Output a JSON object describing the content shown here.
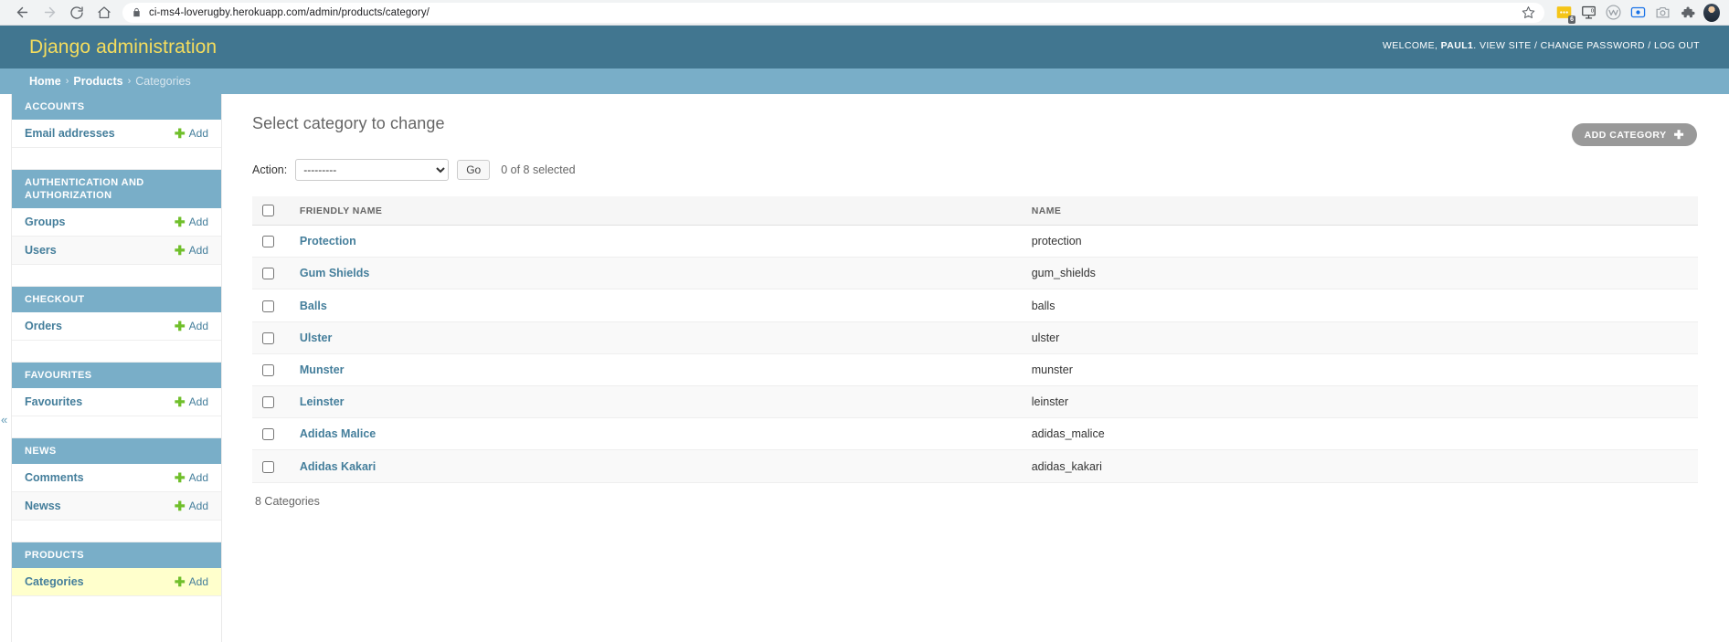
{
  "browser": {
    "back_icon": "arrow-left-icon",
    "forward_icon": "arrow-right-icon",
    "reload_icon": "reload-icon",
    "home_icon": "home-icon",
    "lock_icon": "lock-icon",
    "url_prefix": "ci-ms4-loverugby.herokuapp.com",
    "url_path": "/admin/products/category/",
    "url_full": "ci-ms4-loverugby.herokuapp.com/admin/products/category/",
    "star_icon": "bookmark-star-icon",
    "extensions": [
      {
        "name": "notes-extension-icon",
        "badge": "6"
      },
      {
        "name": "screen-capture-extension-icon",
        "badge": ""
      },
      {
        "name": "wave-extension-icon",
        "badge": ""
      },
      {
        "name": "recorder-extension-icon",
        "badge": ""
      },
      {
        "name": "camera-extension-icon",
        "badge": ""
      },
      {
        "name": "puzzle-extensions-icon",
        "badge": ""
      }
    ],
    "profile_icon": "user-avatar-icon"
  },
  "header": {
    "branding": "Django administration",
    "welcome_prefix": "WELCOME,",
    "username": "PAUL1",
    "punct": ".",
    "view_site": "VIEW SITE",
    "change_password": "CHANGE PASSWORD",
    "log_out": "LOG OUT",
    "separator": "/"
  },
  "breadcrumbs": {
    "items": [
      {
        "label": "Home",
        "current": false
      },
      {
        "label": "Products",
        "current": false
      },
      {
        "label": "Categories",
        "current": true
      }
    ],
    "separator": "›"
  },
  "sidebar": {
    "toggle_icon": "collapse-sidebar-icon",
    "toggle_label": "«",
    "add_label": "Add",
    "add_icon": "plus-icon",
    "apps": [
      {
        "title": "ACCOUNTS",
        "models": [
          {
            "label": "Email addresses",
            "current": false
          }
        ]
      },
      {
        "title": "AUTHENTICATION AND AUTHORIZATION",
        "models": [
          {
            "label": "Groups",
            "current": false
          },
          {
            "label": "Users",
            "current": false
          }
        ]
      },
      {
        "title": "CHECKOUT",
        "models": [
          {
            "label": "Orders",
            "current": false
          }
        ]
      },
      {
        "title": "FAVOURITES",
        "models": [
          {
            "label": "Favourites",
            "current": false
          }
        ]
      },
      {
        "title": "NEWS",
        "models": [
          {
            "label": "Comments",
            "current": false
          },
          {
            "label": "Newss",
            "current": false
          }
        ]
      },
      {
        "title": "PRODUCTS",
        "models": [
          {
            "label": "Categories",
            "current": true
          }
        ]
      }
    ]
  },
  "main": {
    "title": "Select category to change",
    "add_button": "ADD CATEGORY",
    "add_button_icon": "plus-icon",
    "action_label": "Action:",
    "action_selected": "---------",
    "action_options": [
      "---------"
    ],
    "go_button": "Go",
    "selection_counter": "0 of 8 selected",
    "select_all_icon": "select-all-checkbox",
    "columns": [
      "FRIENDLY NAME",
      "NAME"
    ],
    "rows": [
      {
        "friendly_name": "Protection",
        "name": "protection"
      },
      {
        "friendly_name": "Gum Shields",
        "name": "gum_shields"
      },
      {
        "friendly_name": "Balls",
        "name": "balls"
      },
      {
        "friendly_name": "Ulster",
        "name": "ulster"
      },
      {
        "friendly_name": "Munster",
        "name": "munster"
      },
      {
        "friendly_name": "Leinster",
        "name": "leinster"
      },
      {
        "friendly_name": "Adidas Malice",
        "name": "adidas_malice"
      },
      {
        "friendly_name": "Adidas Kakari",
        "name": "adidas_kakari"
      }
    ],
    "result_count": "8 Categories"
  },
  "colors": {
    "header_bg": "#417690",
    "breadcrumb_bg": "#79aec8",
    "branding_text": "#f5dd5d",
    "link": "#447e9b",
    "add_green": "#70bf2b",
    "current_row": "#ffffcc",
    "button_gray": "#999999"
  }
}
